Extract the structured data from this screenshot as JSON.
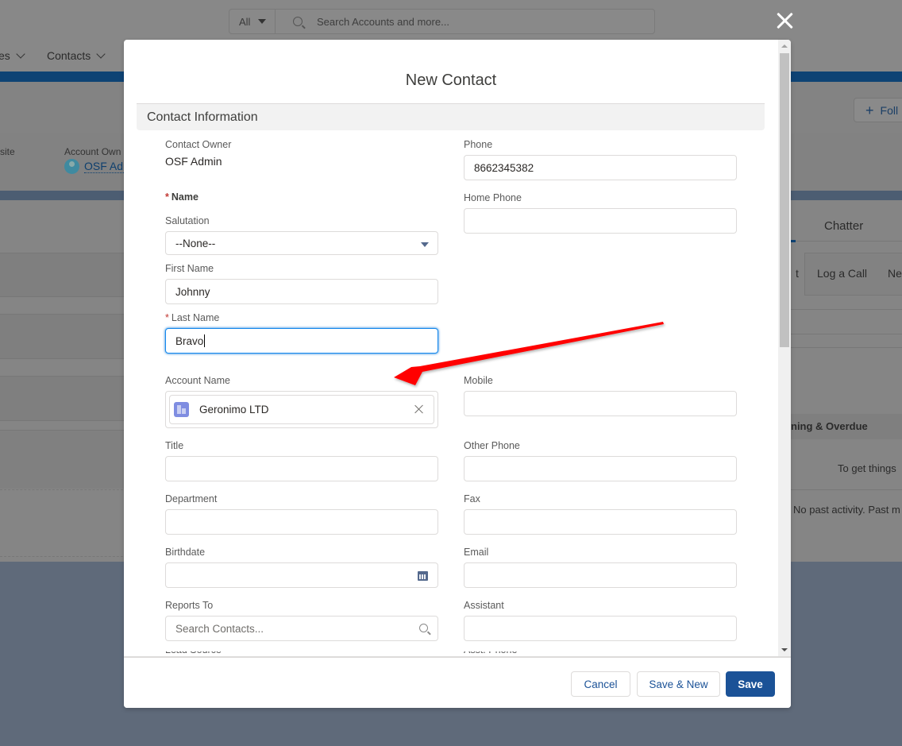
{
  "background": {
    "search": {
      "scope": "All",
      "placeholder": "Search Accounts and more..."
    },
    "nav": [
      {
        "label": "es"
      },
      {
        "label": "Contacts"
      }
    ],
    "follow_label": "Foll",
    "highlights": {
      "site_label": "site",
      "owner_label": "Account Own",
      "owner_name": "OSF Adr"
    },
    "right_panel": {
      "tab": "Chatter",
      "actions": [
        "t",
        "Log a Call",
        "Ne"
      ],
      "upcoming": "ning & Overdue",
      "get_started": "To get things",
      "no_past": "No past activity. Past m"
    }
  },
  "modal": {
    "title": "New Contact",
    "section": "Contact Information",
    "left": {
      "contact_owner_label": "Contact Owner",
      "contact_owner_value": "OSF Admin",
      "name_label": "Name",
      "salutation_label": "Salutation",
      "salutation_value": "--None--",
      "first_name_label": "First Name",
      "first_name_value": "Johnny",
      "last_name_label": "Last Name",
      "last_name_value": "Bravo",
      "account_name_label": "Account Name",
      "account_name_value": "Geronimo LTD",
      "title_label": "Title",
      "title_value": "",
      "department_label": "Department",
      "department_value": "",
      "birthdate_label": "Birthdate",
      "birthdate_value": "",
      "reports_to_label": "Reports To",
      "reports_to_placeholder": "Search Contacts...",
      "next_label_cut": "Lead Source"
    },
    "right": {
      "phone_label": "Phone",
      "phone_value": "8662345382",
      "home_phone_label": "Home Phone",
      "home_phone_value": "",
      "mobile_label": "Mobile",
      "mobile_value": "",
      "other_phone_label": "Other Phone",
      "other_phone_value": "",
      "fax_label": "Fax",
      "fax_value": "",
      "email_label": "Email",
      "email_value": "",
      "assistant_label": "Assistant",
      "assistant_value": "",
      "next_label_cut": "Asst. Phone"
    },
    "required_mark": "*",
    "footer": {
      "cancel": "Cancel",
      "save_new": "Save & New",
      "save": "Save"
    }
  },
  "annotation": {
    "type": "arrow",
    "color": "#ff0000",
    "points_to": "account-name-field"
  }
}
